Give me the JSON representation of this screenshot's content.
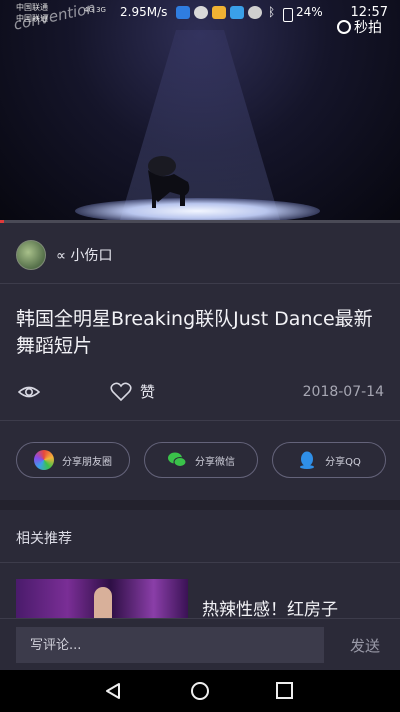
{
  "status_bar": {
    "carrier1": "中国联通",
    "carrier2": "中国联通",
    "network": "4G 3G",
    "speed": "2.95M/s",
    "battery": "24%",
    "time": "12:57"
  },
  "watermark": {
    "left": "convention",
    "right": "秒拍"
  },
  "video": {
    "progress_percent": 1
  },
  "author": {
    "name": "∝ 小伤口"
  },
  "title": "韩国全明星Breaking联队Just Dance最新舞蹈短片",
  "actions": {
    "like_label": "赞",
    "date": "2018-07-14"
  },
  "share": {
    "moments": "分享朋友圈",
    "wechat": "分享微信",
    "qq": "分享QQ"
  },
  "related": {
    "heading": "相关推荐",
    "items": [
      {
        "title": "热辣性感！红房子"
      }
    ]
  },
  "comment": {
    "placeholder": "写评论...",
    "send_label": "发送"
  },
  "colors": {
    "accent": "#e03a3a",
    "background": "#2b2a38"
  }
}
